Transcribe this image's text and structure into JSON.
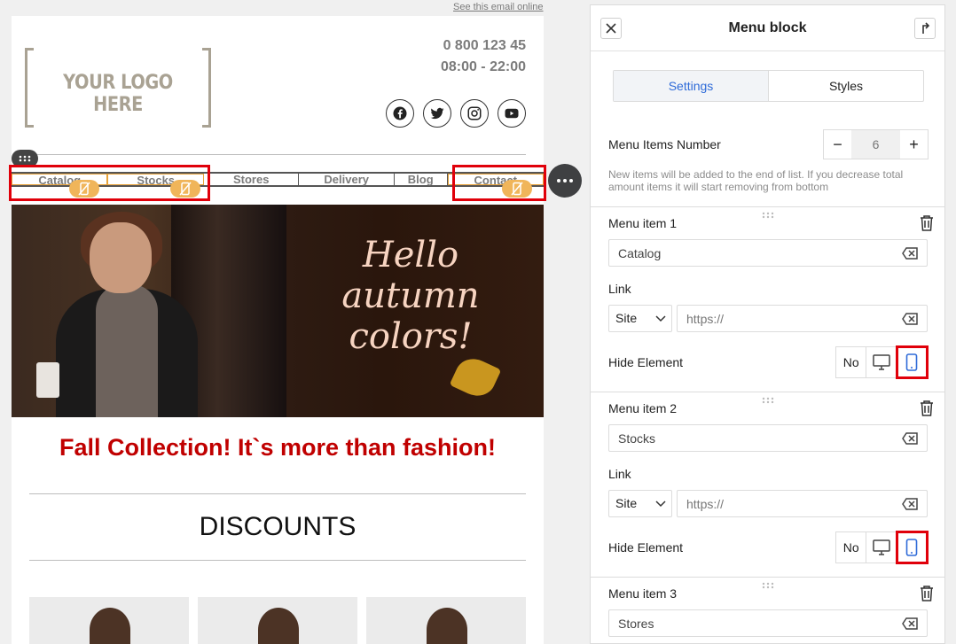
{
  "email": {
    "see_online": "See this email online",
    "logo_text": "YOUR LOGO HERE",
    "phone": "0 800 123 45",
    "hours": "08:00 - 22:00",
    "socials": [
      "facebook-icon",
      "twitter-icon",
      "instagram-icon",
      "youtube-icon"
    ],
    "menu_items": [
      "Catalog",
      "Stocks",
      "Stores",
      "Delivery",
      "Blog",
      "Contact"
    ],
    "banner_text": [
      "Hello",
      "autumn",
      "colors!"
    ],
    "headline": "Fall Collection! It`s more than fashion!",
    "section_title": "DISCOUNTS"
  },
  "panel": {
    "title": "Menu block",
    "tabs": [
      "Settings",
      "Styles"
    ],
    "active_tab": "Settings",
    "items_number_label": "Menu Items Number",
    "items_number_value": "6",
    "hint": "New items will be added to the end of list. If you decrease total amount items it will start removing from bottom",
    "link_label": "Link",
    "hide_label": "Hide Element",
    "hide_no": "No",
    "items": [
      {
        "title": "Menu item 1",
        "value": "Catalog",
        "link_type": "Site",
        "link_placeholder": "https://"
      },
      {
        "title": "Menu item 2",
        "value": "Stocks",
        "link_type": "Site",
        "link_placeholder": "https://"
      },
      {
        "title": "Menu item 3",
        "value": "Stores"
      }
    ]
  },
  "colors": {
    "accent_blue": "#2f6bd8",
    "highlight_red": "#e0000a",
    "headline_red": "#c00000",
    "hidden_badge": "#f0b55a"
  }
}
